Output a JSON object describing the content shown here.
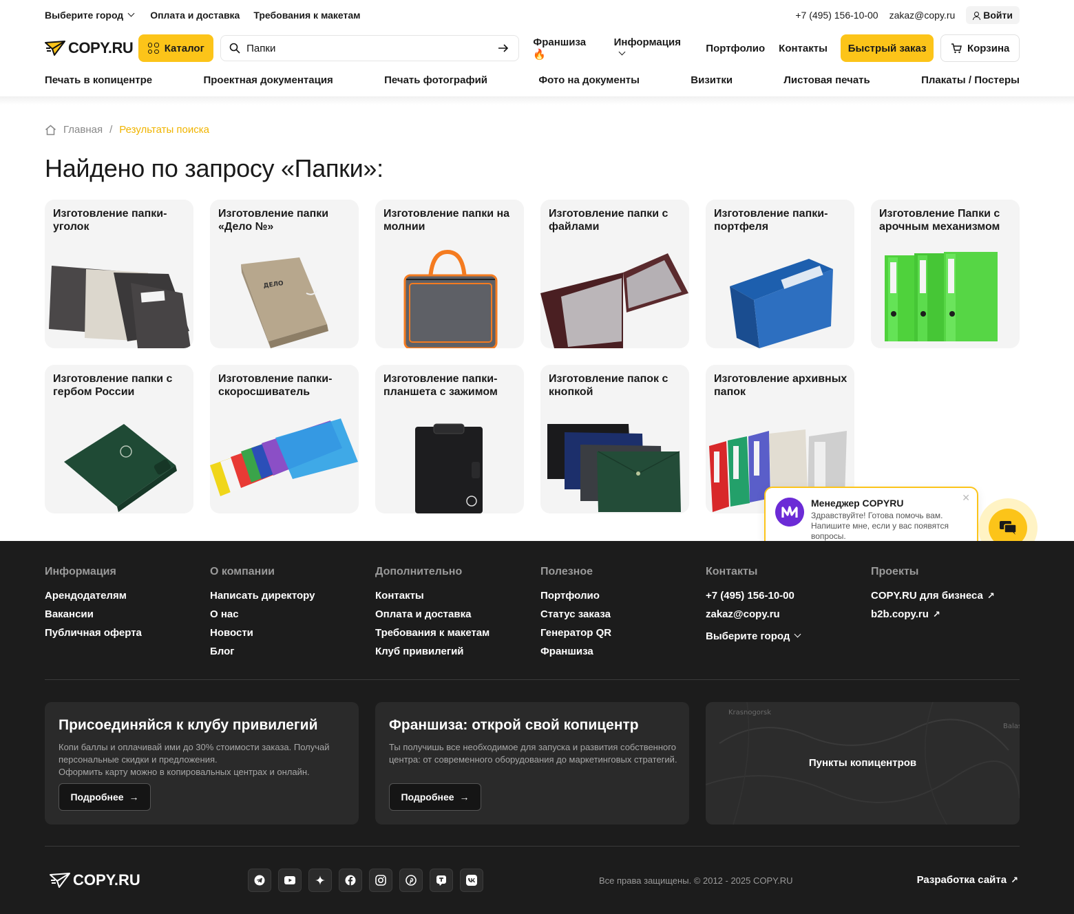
{
  "topbar": {
    "city": "Выберите город",
    "payment": "Оплата и доставка",
    "requirements": "Требования к макетам",
    "phone": "+7 (495) 156-10-00",
    "email": "zakaz@copy.ru",
    "login": "Войти"
  },
  "header": {
    "logo": "COPY.RU",
    "catalog": "Каталог",
    "search_value": "Папки",
    "nav": {
      "franchise": "Франшиза 🔥",
      "info": "Информация",
      "portfolio": "Портфолио",
      "contacts": "Контакты"
    },
    "fast_order": "Быстрый заказ",
    "cart": "Корзина"
  },
  "catnav": [
    "Печать в копицентре",
    "Проектная документация",
    "Печать фотографий",
    "Фото на документы",
    "Визитки",
    "Листовая печать",
    "Плакаты / Постеры"
  ],
  "breadcrumb": {
    "home": "Главная",
    "separator": "/",
    "current": "Результаты поиска"
  },
  "page_title": "Найдено по запросу «Папки»:",
  "cards": [
    {
      "title": "Изготовление папки-уголок",
      "icon": "folder-corner-image"
    },
    {
      "title": "Изготовление папки «Дело №»",
      "icon": "case-folder-image"
    },
    {
      "title": "Изготовление папки на молнии",
      "icon": "zip-bag-image"
    },
    {
      "title": "Изготовление папки с файлами",
      "icon": "sheet-protector-folder-image"
    },
    {
      "title": "Изготовление папки-портфеля",
      "icon": "expanding-file-image"
    },
    {
      "title": "Изготовление Папки с арочным механизмом",
      "icon": "lever-arch-file-image"
    },
    {
      "title": "Изготовление папки с гербом России",
      "icon": "emblem-folder-image"
    },
    {
      "title": "Изготовление папки-скоросшиватель",
      "icon": "binder-folders-image"
    },
    {
      "title": "Изготовление папки-планшета с зажимом",
      "icon": "clipboard-image"
    },
    {
      "title": "Изготовление папок с кнопкой",
      "icon": "button-envelope-image"
    },
    {
      "title": "Изготовление архивных папок",
      "icon": "archive-box-image"
    }
  ],
  "chat": {
    "name": "Менеджер COPYRU",
    "message": "Здравствуйте! Готова помочь вам. Напишите мне, если у вас появятся вопросы."
  },
  "footer": {
    "columns": [
      {
        "title": "Информация",
        "links": [
          "Арендодателям",
          "Вакансии",
          "Публичная оферта"
        ]
      },
      {
        "title": "О компании",
        "links": [
          "Написать директору",
          "О нас",
          "Новости",
          "Блог"
        ]
      },
      {
        "title": "Дополнительно",
        "links": [
          "Контакты",
          "Оплата и доставка",
          "Требования к макетам",
          "Клуб привилегий"
        ]
      },
      {
        "title": "Полезное",
        "links": [
          "Портфолио",
          "Статус заказа",
          "Генератор QR",
          "Франшиза"
        ]
      },
      {
        "title": "Контакты",
        "links": [
          "+7 (495) 156-10-00",
          "zakaz@copy.ru",
          "Выберите город"
        ]
      },
      {
        "title": "Проекты",
        "links": [
          "COPY.RU для бизнеса",
          "b2b.copy.ru"
        ]
      }
    ],
    "club": {
      "title": "Присоединяйся к клубу привилегий",
      "text1": "Копи баллы и оплачивай ими до 30% стоимости заказа. Получай персональные скидки и предложения.",
      "text2": "Оформить карту можно в копировальных центрах и онлайн.",
      "button": "Подробнее"
    },
    "franchise": {
      "title": "Франшиза: открой свой копицентр",
      "text": "Ты получишь все необходимое для запуска и развития собственного центра: от современного оборудования до маркетинговых стратегий.",
      "button": "Подробнее"
    },
    "map": {
      "label": "Пункты копицентров",
      "place1": "Krasnogorsk",
      "place2": "Balash"
    },
    "logo": "COPY.RU",
    "social_icons": [
      "telegram-icon",
      "youtube-icon",
      "dzen-icon",
      "facebook-icon",
      "instagram-icon",
      "pinterest-icon",
      "tenchat-icon",
      "vk-icon"
    ],
    "copyright": "Все права защищены. © 2012 - 2025 COPY.RU",
    "dev": "Разработка сайта"
  },
  "colors": {
    "accent": "#fcc419",
    "footer_bg": "#1c1c1c",
    "card_bg": "#f4f4f4",
    "breadcrumb_active": "#f0b400"
  }
}
